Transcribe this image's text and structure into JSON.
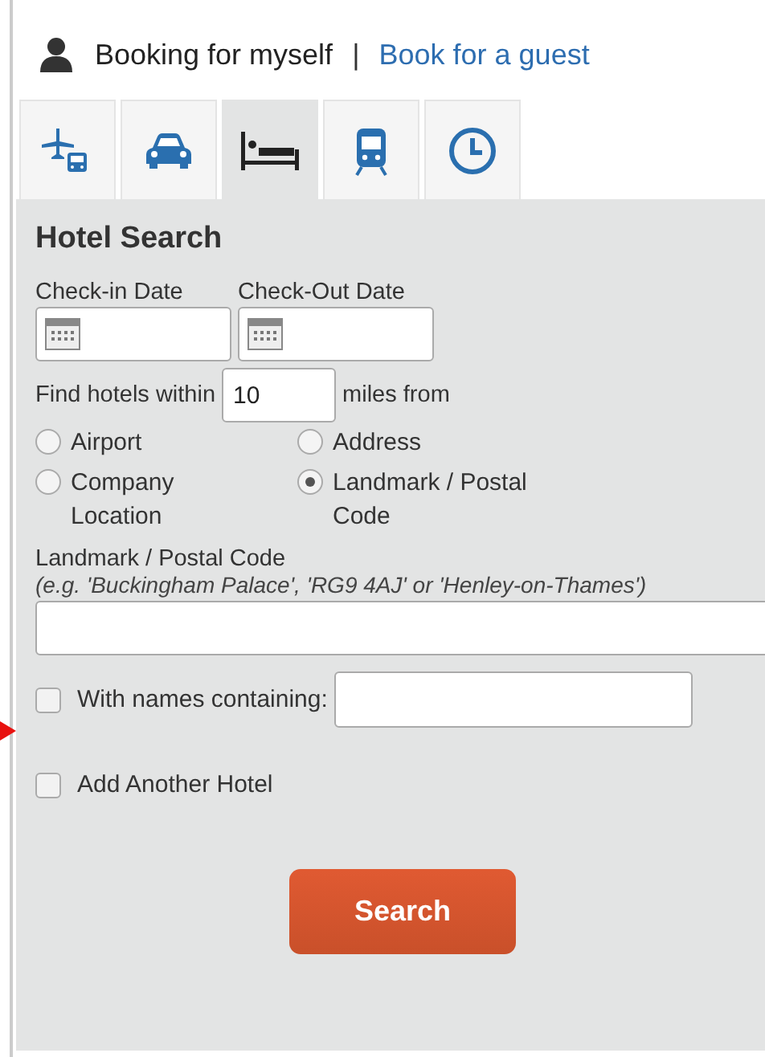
{
  "booking": {
    "self_label": "Booking for myself",
    "separator": "|",
    "guest_link": "Book for a guest"
  },
  "tabs": [
    {
      "kind": "flight",
      "selected": false
    },
    {
      "kind": "car",
      "selected": false
    },
    {
      "kind": "hotel",
      "selected": true
    },
    {
      "kind": "train",
      "selected": false
    },
    {
      "kind": "clock",
      "selected": false
    }
  ],
  "form": {
    "title": "Hotel Search",
    "checkin_label": "Check-in Date",
    "checkout_label": "Check-Out Date",
    "within_label": "Find hotels within",
    "within_value": "10",
    "within_unit": "miles from",
    "locations": [
      {
        "label": "Airport",
        "selected": false
      },
      {
        "label": "Address",
        "selected": false
      },
      {
        "label": "Company Location",
        "selected": false
      },
      {
        "label": "Landmark / Postal Code",
        "selected": true
      }
    ],
    "landmark_label": "Landmark / Postal Code",
    "landmark_hint": "(e.g. 'Buckingham Palace', 'RG9 4AJ' or 'Henley-on-Thames')",
    "names_option": {
      "label": "With names containing:",
      "checked": false
    },
    "another_option": {
      "label": "Add Another Hotel",
      "checked": false
    },
    "search_button": "Search"
  }
}
